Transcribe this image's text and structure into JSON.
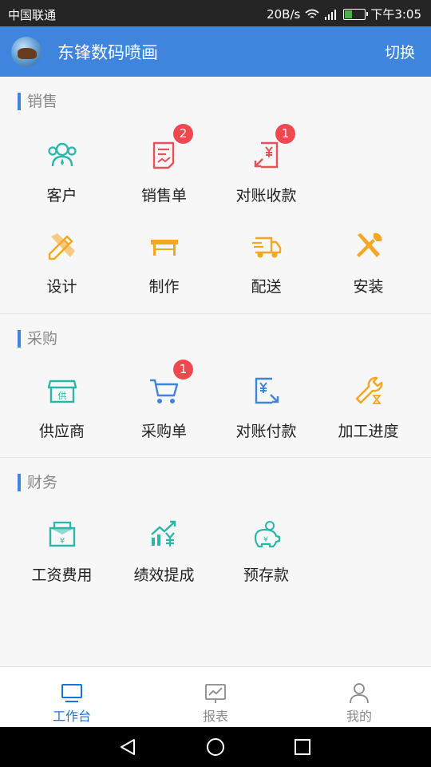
{
  "status": {
    "carrier": "中国联通",
    "speed": "20B/s",
    "time": "下午3:05"
  },
  "header": {
    "title": "东锋数码喷画",
    "switch_label": "切换"
  },
  "sections": [
    {
      "title": "销售",
      "items": [
        {
          "label": "客户",
          "icon": "customers-icon"
        },
        {
          "label": "销售单",
          "icon": "sales-order-icon",
          "badge": "2"
        },
        {
          "label": "对账收款",
          "icon": "reconcile-receipt-icon",
          "badge": "1"
        },
        {
          "label": "设计",
          "icon": "design-icon"
        },
        {
          "label": "制作",
          "icon": "production-icon"
        },
        {
          "label": "配送",
          "icon": "delivery-truck-icon"
        },
        {
          "label": "安装",
          "icon": "install-tools-icon"
        }
      ]
    },
    {
      "title": "采购",
      "items": [
        {
          "label": "供应商",
          "icon": "supplier-shop-icon"
        },
        {
          "label": "采购单",
          "icon": "shopping-cart-icon",
          "badge": "1"
        },
        {
          "label": "对账付款",
          "icon": "reconcile-payment-icon"
        },
        {
          "label": "加工进度",
          "icon": "processing-wrench-icon"
        }
      ]
    },
    {
      "title": "财务",
      "items": [
        {
          "label": "工资费用",
          "icon": "salary-envelope-icon"
        },
        {
          "label": "绩效提成",
          "icon": "performance-chart-icon"
        },
        {
          "label": "预存款",
          "icon": "piggy-bank-icon"
        }
      ]
    }
  ],
  "bottom_nav": [
    {
      "label": "工作台",
      "icon": "workbench-monitor-icon",
      "active": true
    },
    {
      "label": "报表",
      "icon": "report-chart-icon",
      "active": false
    },
    {
      "label": "我的",
      "icon": "profile-person-icon",
      "active": false
    }
  ],
  "colors": {
    "header": "#3f85dd",
    "teal": "#2ab7a9",
    "orange": "#f5a623",
    "red": "#e5525b",
    "blue": "#3f85dd",
    "badge": "#f0484f"
  }
}
